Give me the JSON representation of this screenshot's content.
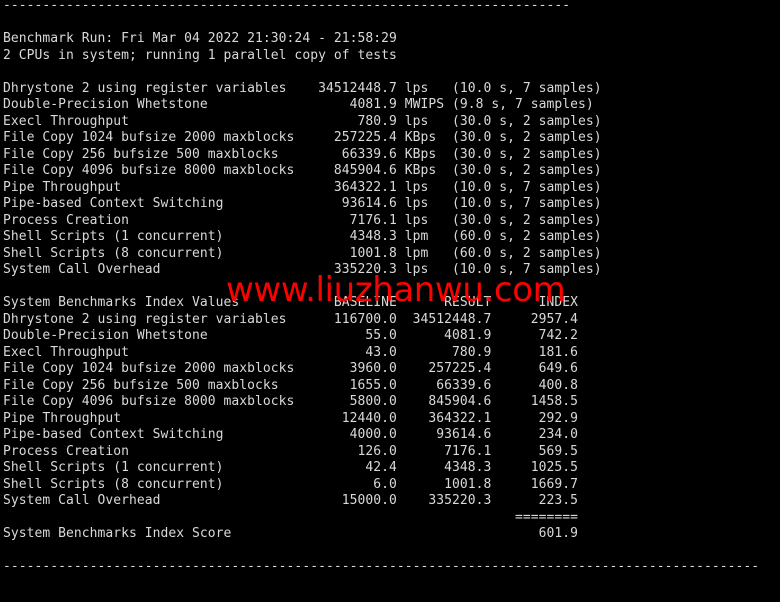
{
  "terminal": {
    "background_color": "#000000",
    "text_color": "#d9d9d9",
    "watermark_color": "#ff0000",
    "watermark": "www.liuzhanwu.com",
    "top_rule": "------------------------------------------------------------------------",
    "bottom_rule": "------------------------------------------------------------------------------------------------",
    "header": {
      "benchmark_run": "Benchmark Run: Fri Mar 04 2022 21:30:24 - 21:58:29",
      "cpu_line": "2 CPUs in system; running 1 parallel copy of tests"
    },
    "raw_results": [
      {
        "name": "Dhrystone 2 using register variables",
        "value": "34512448.7",
        "unit": "lps",
        "timing": "(10.0 s, 7 samples)"
      },
      {
        "name": "Double-Precision Whetstone",
        "value": "4081.9",
        "unit": "MWIPS",
        "timing": "(9.8 s, 7 samples)"
      },
      {
        "name": "Execl Throughput",
        "value": "780.9",
        "unit": "lps",
        "timing": "(30.0 s, 2 samples)"
      },
      {
        "name": "File Copy 1024 bufsize 2000 maxblocks",
        "value": "257225.4",
        "unit": "KBps",
        "timing": "(30.0 s, 2 samples)"
      },
      {
        "name": "File Copy 256 bufsize 500 maxblocks",
        "value": "66339.6",
        "unit": "KBps",
        "timing": "(30.0 s, 2 samples)"
      },
      {
        "name": "File Copy 4096 bufsize 8000 maxblocks",
        "value": "845904.6",
        "unit": "KBps",
        "timing": "(30.0 s, 2 samples)"
      },
      {
        "name": "Pipe Throughput",
        "value": "364322.1",
        "unit": "lps",
        "timing": "(10.0 s, 7 samples)"
      },
      {
        "name": "Pipe-based Context Switching",
        "value": "93614.6",
        "unit": "lps",
        "timing": "(10.0 s, 7 samples)"
      },
      {
        "name": "Process Creation",
        "value": "7176.1",
        "unit": "lps",
        "timing": "(30.0 s, 2 samples)"
      },
      {
        "name": "Shell Scripts (1 concurrent)",
        "value": "4348.3",
        "unit": "lpm",
        "timing": "(60.0 s, 2 samples)"
      },
      {
        "name": "Shell Scripts (8 concurrent)",
        "value": "1001.8",
        "unit": "lpm",
        "timing": "(60.0 s, 2 samples)"
      },
      {
        "name": "System Call Overhead",
        "value": "335220.3",
        "unit": "lps",
        "timing": "(10.0 s, 7 samples)"
      }
    ],
    "index_section": {
      "title": "System Benchmarks Index Values",
      "columns": [
        "BASELINE",
        "RESULT",
        "INDEX"
      ],
      "rows": [
        {
          "name": "Dhrystone 2 using register variables",
          "baseline": "116700.0",
          "result": "34512448.7",
          "index": "2957.4"
        },
        {
          "name": "Double-Precision Whetstone",
          "baseline": "55.0",
          "result": "4081.9",
          "index": "742.2"
        },
        {
          "name": "Execl Throughput",
          "baseline": "43.0",
          "result": "780.9",
          "index": "181.6"
        },
        {
          "name": "File Copy 1024 bufsize 2000 maxblocks",
          "baseline": "3960.0",
          "result": "257225.4",
          "index": "649.6"
        },
        {
          "name": "File Copy 256 bufsize 500 maxblocks",
          "baseline": "1655.0",
          "result": "66339.6",
          "index": "400.8"
        },
        {
          "name": "File Copy 4096 bufsize 8000 maxblocks",
          "baseline": "5800.0",
          "result": "845904.6",
          "index": "1458.5"
        },
        {
          "name": "Pipe Throughput",
          "baseline": "12440.0",
          "result": "364322.1",
          "index": "292.9"
        },
        {
          "name": "Pipe-based Context Switching",
          "baseline": "4000.0",
          "result": "93614.6",
          "index": "234.0"
        },
        {
          "name": "Process Creation",
          "baseline": "126.0",
          "result": "7176.1",
          "index": "569.5"
        },
        {
          "name": "Shell Scripts (1 concurrent)",
          "baseline": "42.4",
          "result": "4348.3",
          "index": "1025.5"
        },
        {
          "name": "Shell Scripts (8 concurrent)",
          "baseline": "6.0",
          "result": "1001.8",
          "index": "1669.7"
        },
        {
          "name": "System Call Overhead",
          "baseline": "15000.0",
          "result": "335220.3",
          "index": "223.5"
        }
      ],
      "separator": "========",
      "score_label": "System Benchmarks Index Score",
      "score_value": "601.9"
    }
  }
}
